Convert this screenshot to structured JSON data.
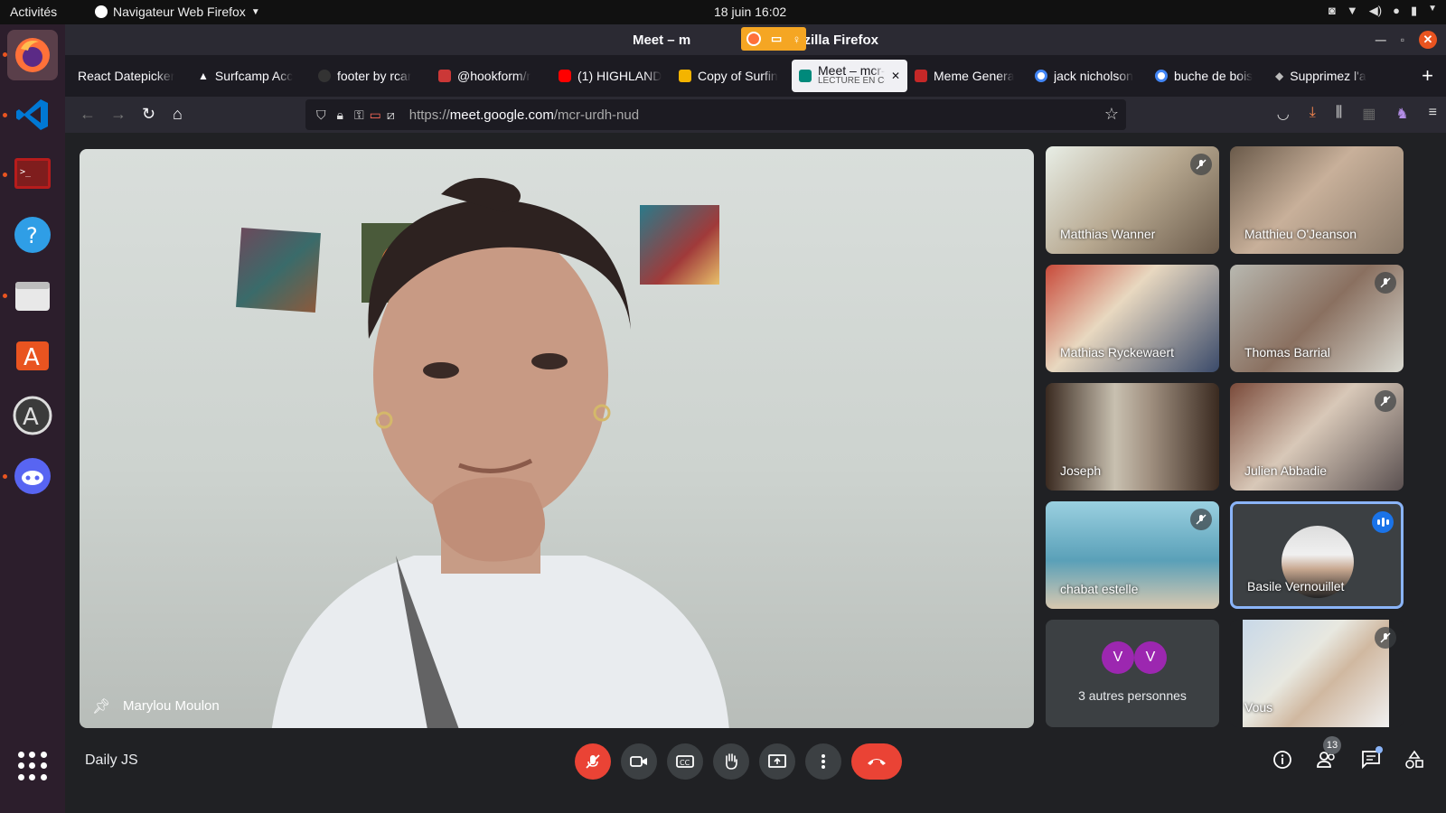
{
  "topbar": {
    "activities": "Activités",
    "app_menu": "Navigateur Web Firefox",
    "clock": "18 juin  16:02"
  },
  "window": {
    "title_left": "Meet – m",
    "title_right": "ud - Mozilla Firefox"
  },
  "tabs": [
    {
      "label": "React Datepicker",
      "color": "#4fc3f7"
    },
    {
      "label": "Surfcamp Acc",
      "color": "#222222"
    },
    {
      "label": "footer by rcar",
      "color": "#333333"
    },
    {
      "label": "@hookform/r",
      "color": "#cb3837"
    },
    {
      "label": "(1) HIGHLAND",
      "color": "#ff0000"
    },
    {
      "label": "Copy of Surfin",
      "color": "#f4b400"
    },
    {
      "label": "Meet – mcr-",
      "sub": "LECTURE EN CO",
      "color": "#00897b",
      "active": true
    },
    {
      "label": "Meme Genera",
      "color": "#c62828"
    },
    {
      "label": "jack nicholson",
      "color": "#4285f4"
    },
    {
      "label": "buche de bois",
      "color": "#4285f4"
    },
    {
      "label": "Supprimez l'a",
      "color": "#9e9e9e"
    }
  ],
  "urlbar": {
    "url_prefix": "https://",
    "url_host": "meet.google.com",
    "url_path": "/mcr-urdh-nud"
  },
  "main_video": {
    "name": "Marylou Moulon"
  },
  "participants": [
    {
      "name": "Matthias Wanner",
      "muted": true
    },
    {
      "name": "Matthieu O'Jeanson",
      "muted": false
    },
    {
      "name": "Mathias Ryckewaert",
      "muted": false
    },
    {
      "name": "Thomas Barrial",
      "muted": true
    },
    {
      "name": "Joseph",
      "muted": false
    },
    {
      "name": "Julien Abbadie",
      "muted": true
    },
    {
      "name": "chabat estelle",
      "muted": true
    },
    {
      "name": "Basile Vernouillet",
      "speaking": true
    },
    {
      "name": "3 autres personnes",
      "avatars": [
        "V",
        "V"
      ]
    },
    {
      "name": "Vous",
      "muted": true
    }
  ],
  "bottom": {
    "meeting_name": "Daily JS",
    "participant_count": "13"
  },
  "colors": {
    "accent_red": "#ea4335",
    "meet_bg": "#202124",
    "dock_accent": "#e95420"
  }
}
